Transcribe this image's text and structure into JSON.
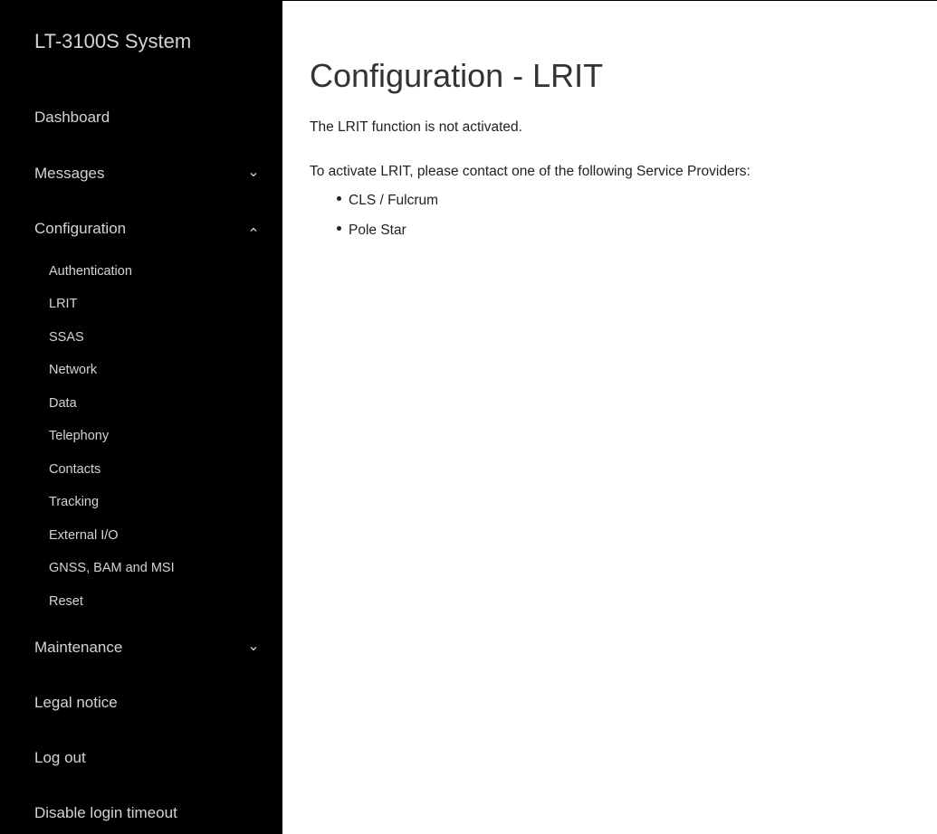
{
  "sidebar": {
    "title": "LT-3100S System",
    "items": [
      {
        "label": "Dashboard"
      },
      {
        "label": "Messages",
        "chevron": "chevron-down-icon"
      },
      {
        "label": "Configuration",
        "chevron": "chevron-up-icon"
      },
      {
        "label": "Maintenance",
        "chevron": "chevron-down-icon"
      },
      {
        "label": "Legal notice"
      },
      {
        "label": "Log out"
      },
      {
        "label": "Disable login timeout"
      }
    ],
    "config_sub": [
      {
        "label": "Authentication"
      },
      {
        "label": "LRIT"
      },
      {
        "label": "SSAS"
      },
      {
        "label": "Network"
      },
      {
        "label": "Data"
      },
      {
        "label": "Telephony"
      },
      {
        "label": "Contacts"
      },
      {
        "label": "Tracking"
      },
      {
        "label": "External I/O"
      },
      {
        "label": "GNSS, BAM and MSI"
      },
      {
        "label": "Reset"
      }
    ]
  },
  "main": {
    "title": "Configuration - LRIT",
    "status_text": "The LRIT function is not activated.",
    "contact_text": "To activate LRIT, please contact one of the following Service Providers:",
    "providers": [
      "CLS / Fulcrum",
      "Pole Star"
    ]
  },
  "colors": {
    "sidebar_bg": "#000000",
    "sidebar_text": "#d4d4d4",
    "title_text": "#333333",
    "body_text": "#222222"
  }
}
